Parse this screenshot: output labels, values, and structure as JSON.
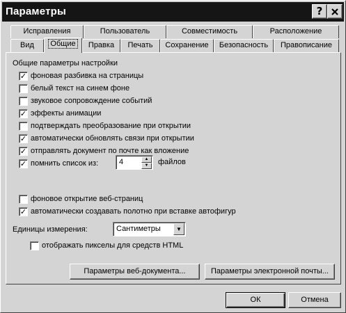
{
  "window": {
    "title": "Параметры"
  },
  "title_buttons": {
    "help": "?",
    "close": "X"
  },
  "tabs_back": [
    "Исправления",
    "Пользователь",
    "Совместимость",
    "Расположение"
  ],
  "tabs_front": [
    "Вид",
    "Общие",
    "Правка",
    "Печать",
    "Сохранение",
    "Безопасность",
    "Правописание"
  ],
  "selected_tab": "Общие",
  "general": {
    "group_label": "Общие параметры настройки",
    "options": [
      {
        "label": "фоновая разбивка на страницы",
        "checked": true
      },
      {
        "label": "белый текст на синем фоне",
        "checked": false
      },
      {
        "label": "звуковое сопровождение событий",
        "checked": false
      },
      {
        "label": "эффекты анимации",
        "checked": true
      },
      {
        "label": "подтверждать преобразование при открытии",
        "checked": false
      },
      {
        "label": "автоматически обновлять связи при открытии",
        "checked": true
      },
      {
        "label": "отправлять документ по почте как вложение",
        "checked": true
      },
      {
        "label": "помнить список из:",
        "checked": true
      }
    ],
    "recent_files_count": "4",
    "recent_files_suffix": "файлов",
    "options2": [
      {
        "label": "фоновое открытие веб-страниц",
        "checked": false
      },
      {
        "label": "автоматически создавать полотно при вставке автофигур",
        "checked": true
      }
    ],
    "units_label": "Единицы измерения:",
    "units_value": "Сантиметры",
    "pixels_label": "отображать пикселы для средств HTML",
    "pixels_checked": false,
    "web_options_button": "Параметры веб-документа...",
    "email_options_button": "Параметры электронной почты..."
  },
  "footer": {
    "ok": "ОК",
    "cancel": "Отмена"
  }
}
